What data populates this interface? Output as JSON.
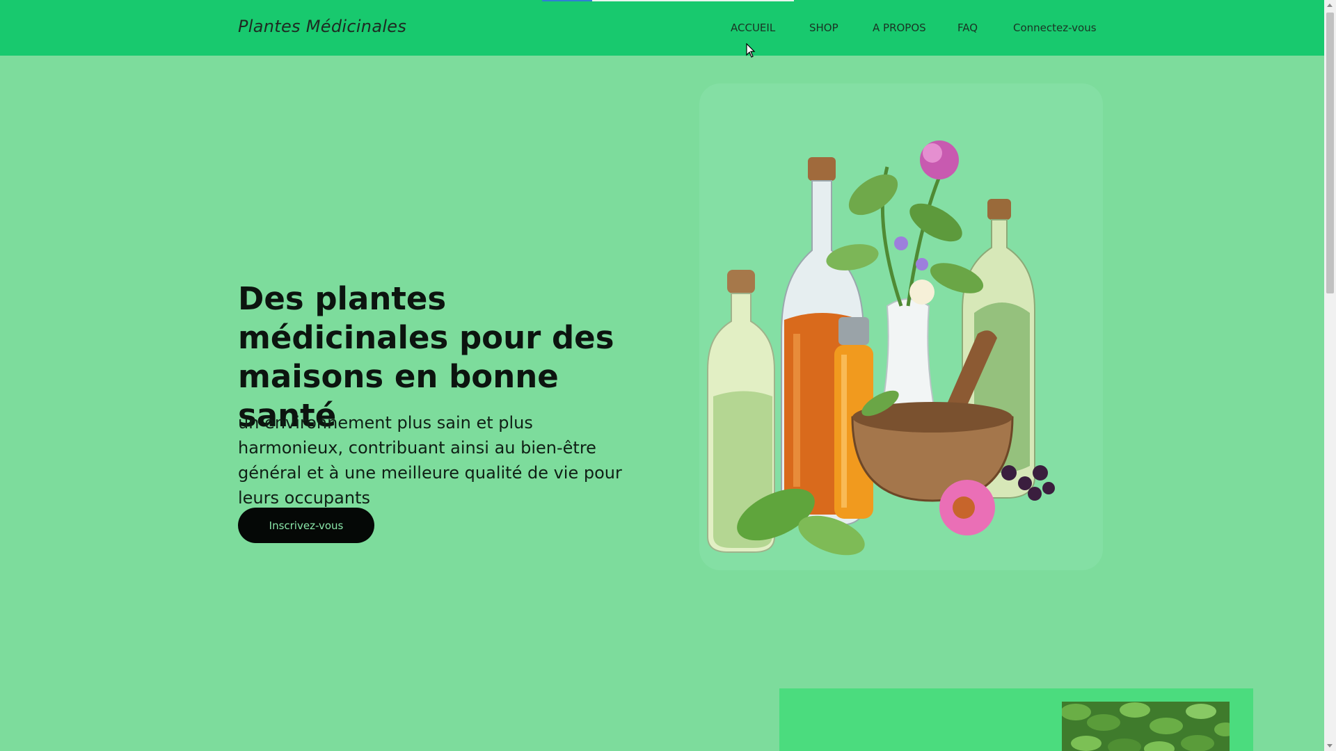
{
  "header": {
    "logo": "Plantes Médicinales",
    "nav": [
      {
        "label": "ACCUEIL"
      },
      {
        "label": "SHOP"
      },
      {
        "label": "A PROPOS"
      },
      {
        "label": "FAQ"
      },
      {
        "label": "Connectez-vous"
      }
    ]
  },
  "hero": {
    "title": "Des plantes médicinales pour des maisons en bonne santé",
    "subtitle": "un environnement plus sain et plus harmonieux, contribuant ainsi au bien-être général et à une meilleure qualité de vie pour leurs occupants",
    "cta": "Inscrivez-vous"
  },
  "colors": {
    "header_bg": "#18c96e",
    "page_bg": "#7ddc9c",
    "card_bg": "#4bdc7e",
    "button_bg": "#050806",
    "button_text": "#8ae6a9"
  },
  "icons": {
    "cursor": "mouse-pointer-icon",
    "hero_image": "medicinal-herbs-bottles-illustration",
    "card_image": "green-leaves-photo"
  }
}
